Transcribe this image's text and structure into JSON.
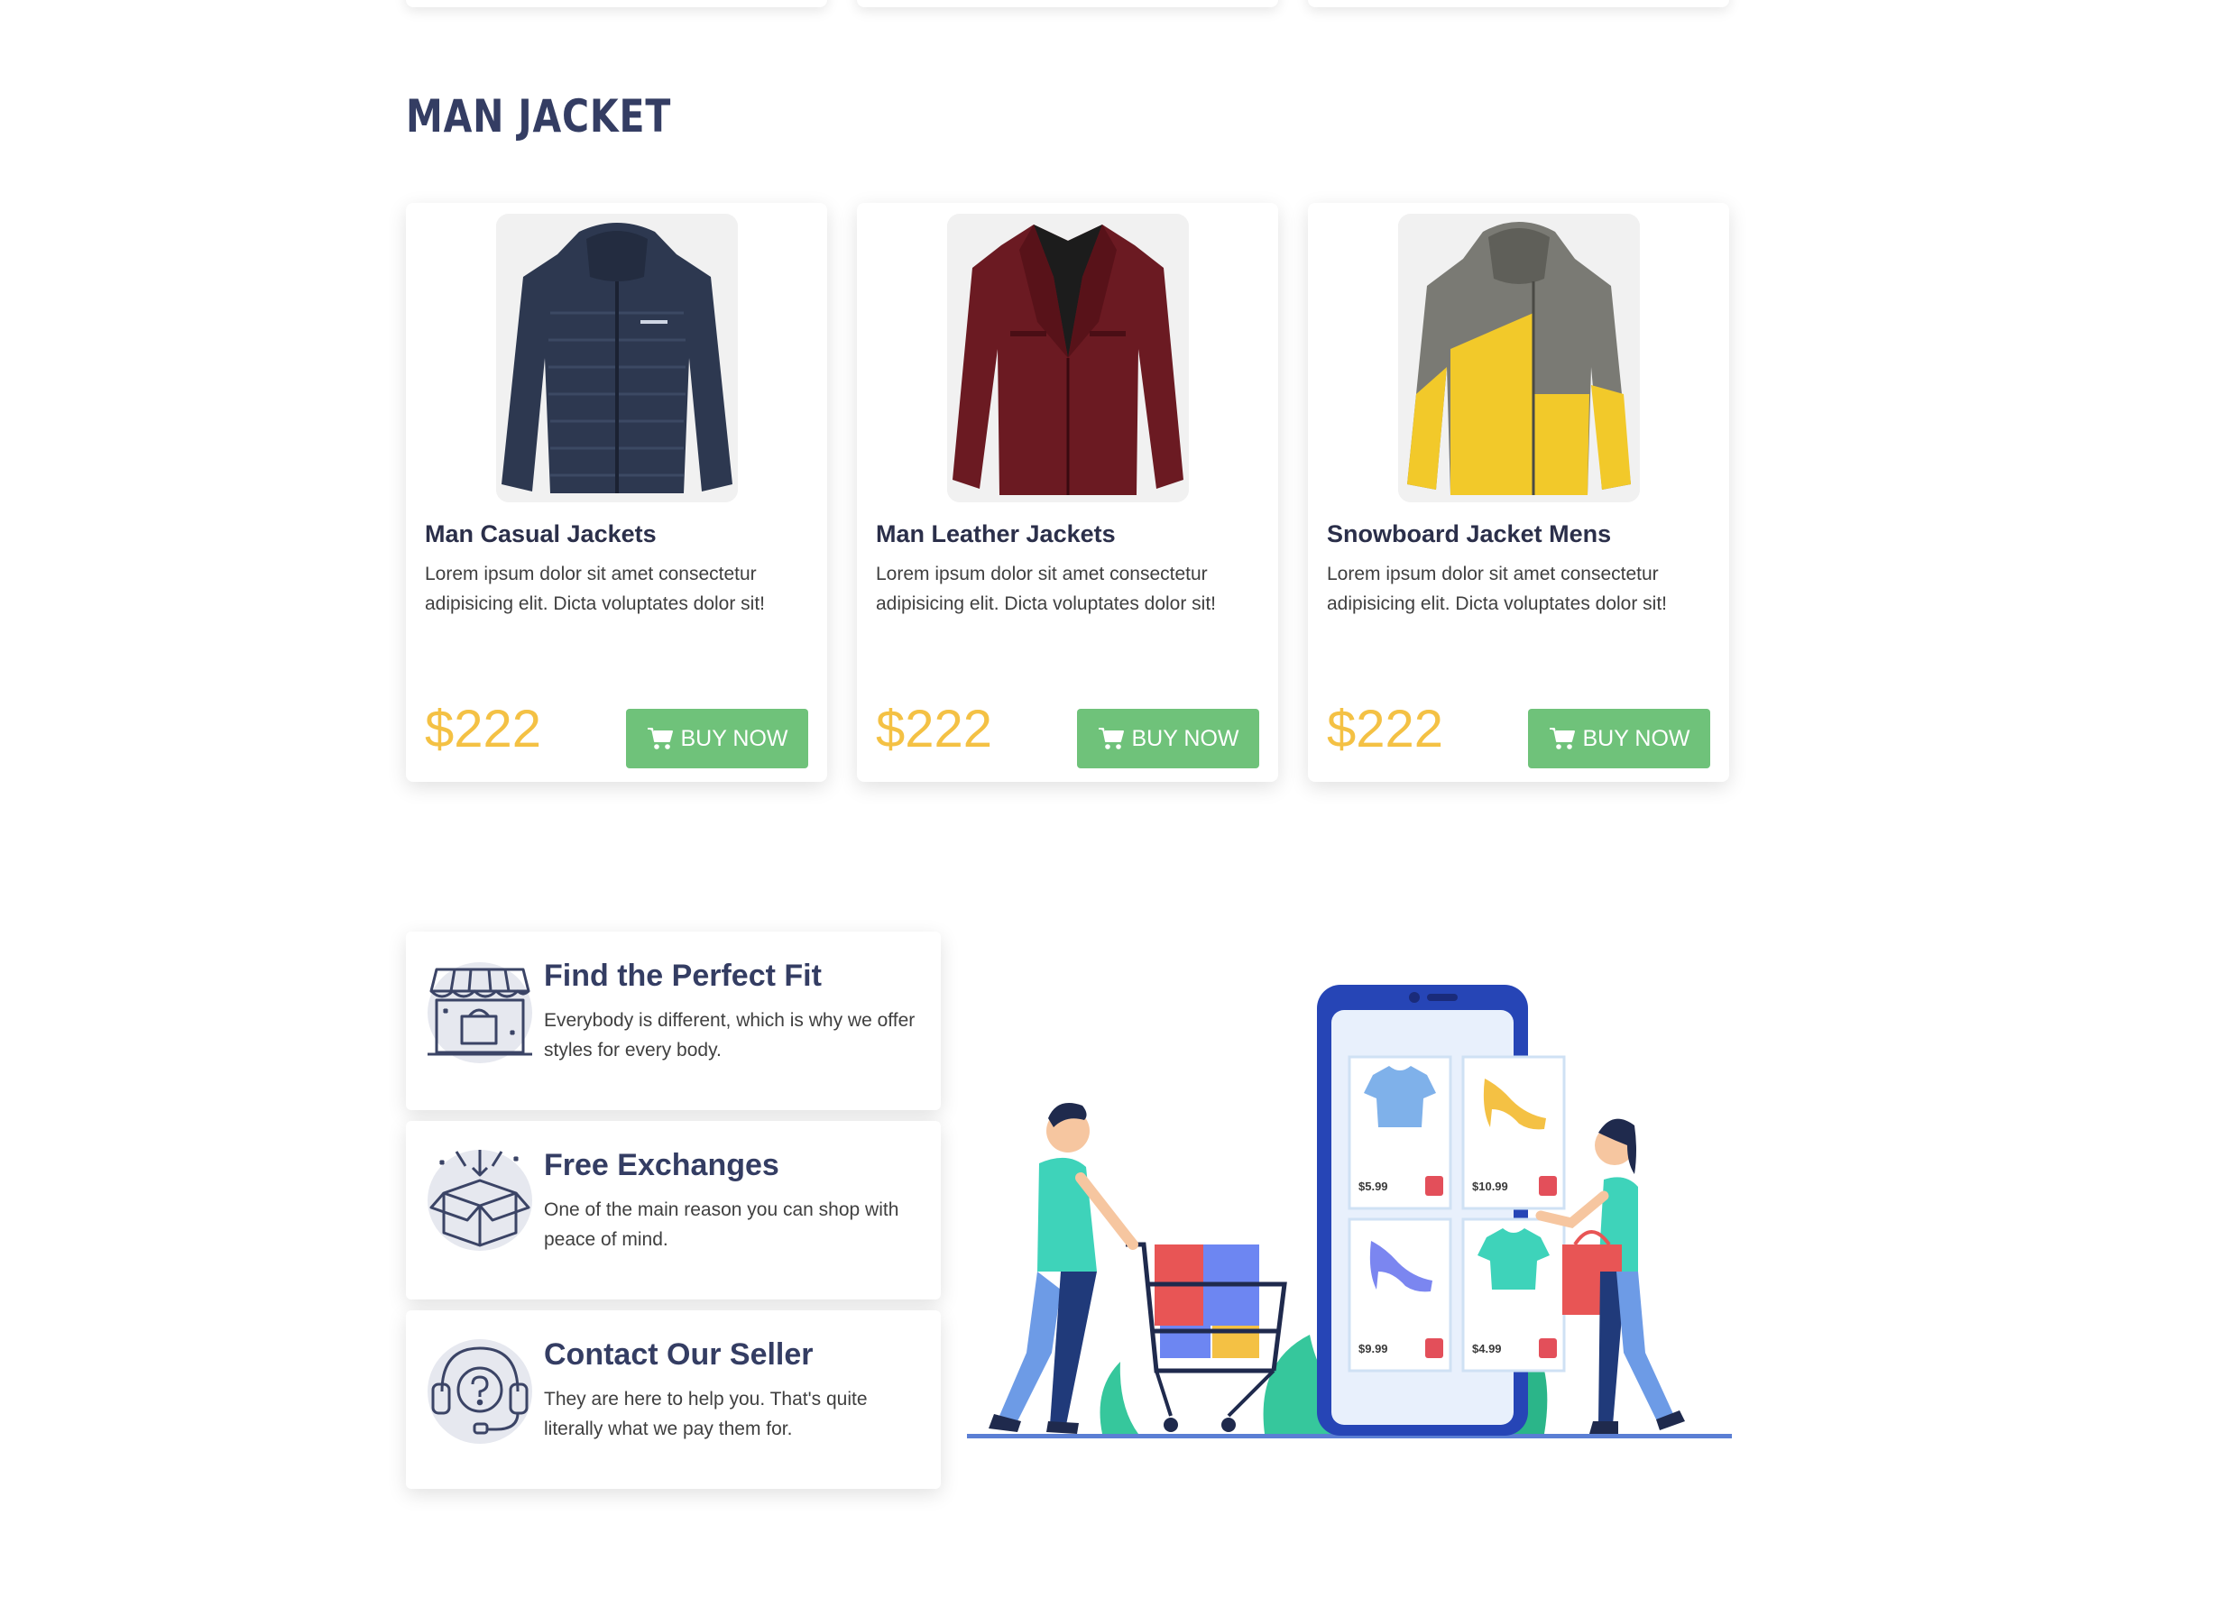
{
  "section": {
    "title": "MAN JACKET"
  },
  "products": [
    {
      "title": "Man Casual Jackets",
      "description": "Lorem ipsum dolor sit amet consectetur adipisicing elit. Dicta voluptates dolor sit!",
      "price": "$222",
      "button_label": "BUY NOW",
      "image": "navy-puffer-jacket"
    },
    {
      "title": "Man Leather Jackets",
      "description": "Lorem ipsum dolor sit amet consectetur adipisicing elit. Dicta voluptates dolor sit!",
      "price": "$222",
      "button_label": "BUY NOW",
      "image": "burgundy-leather-jacket"
    },
    {
      "title": "Snowboard Jacket Mens",
      "description": "Lorem ipsum dolor sit amet consectetur adipisicing elit. Dicta voluptates dolor sit!",
      "price": "$222",
      "button_label": "BUY NOW",
      "image": "grey-yellow-snowboard-jacket"
    }
  ],
  "features": [
    {
      "title": "Find the Perfect Fit",
      "description": "Everybody is different, which is why we offer styles for every body.",
      "icon": "storefront-icon"
    },
    {
      "title": "Free Exchanges",
      "description": "One of the main reason you can shop with peace of mind.",
      "icon": "open-box-icon"
    },
    {
      "title": "Contact Our Seller",
      "description": "They are here to help you. That's quite literally what we pay them for.",
      "icon": "headset-support-icon"
    }
  ],
  "illustration": {
    "prices": [
      "$5.99",
      "$10.99",
      "$9.99",
      "$4.99"
    ]
  },
  "colors": {
    "heading": "#343d63",
    "price": "#f4c144",
    "button": "#6fc27a",
    "card_bg": "#ffffff"
  }
}
